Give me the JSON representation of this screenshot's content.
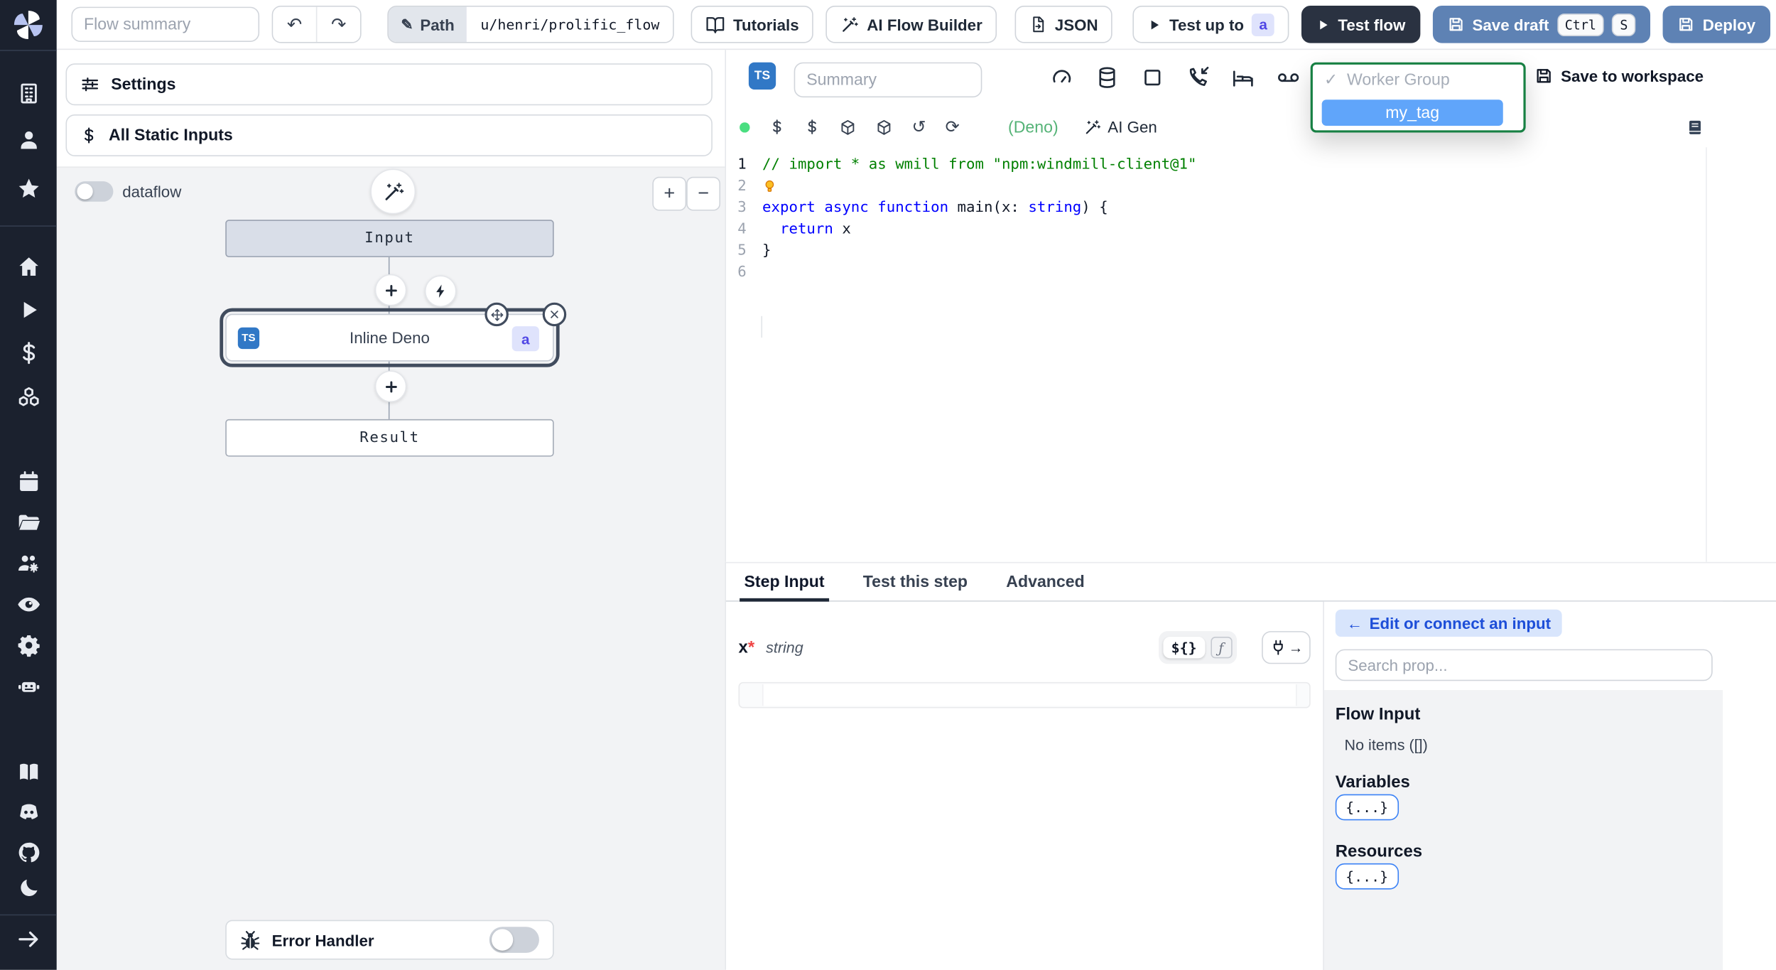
{
  "colors": {
    "sidebar_bg": "#1b212e",
    "primary_blue": "#5e82b4",
    "dark_button": "#2a3241",
    "badge_bg": "#dfe3fc",
    "badge_text": "#4f46e5",
    "ts_blue": "#3178c6",
    "selected_ring": "#414c5e",
    "dropdown_border": "#178043",
    "tag_bg": "#60a5fa",
    "canvas_bg": "#f2f3f5",
    "code_comment": "#008000",
    "code_keyword": "#0000ff",
    "deno_green": "#55b377",
    "link_blue": "#1d4ed8",
    "link_bg": "#d8e5fc",
    "obj_badge_border": "#3b82f6",
    "status_dot": "#4ade80"
  },
  "sidebar": {
    "items": [
      "windmill-logo",
      "building",
      "person",
      "star",
      "home",
      "play",
      "dollar",
      "cubes",
      "calendar",
      "folder-open",
      "users-gear",
      "eye",
      "gear",
      "robot",
      "book",
      "discord",
      "github",
      "moon",
      "arrow-right"
    ]
  },
  "topbar": {
    "flow_summary_placeholder": "Flow summary",
    "path_label": "Path",
    "path_value": "u/henri/prolific_flow",
    "tutorials_label": "Tutorials",
    "ai_flow_builder_label": "AI Flow Builder",
    "json_label": "JSON",
    "test_up_to_label": "Test up to",
    "test_up_to_badge": "a",
    "test_flow_label": "Test flow",
    "save_draft_label": "Save draft",
    "save_draft_kbd": [
      "Ctrl",
      "S"
    ],
    "deploy_label": "Deploy"
  },
  "flow_panel": {
    "settings_label": "Settings",
    "static_inputs_label": "All Static Inputs",
    "dataflow_label": "dataflow",
    "zoom_in_label": "+",
    "zoom_out_label": "−",
    "nodes": {
      "input_label": "Input",
      "step_label": "Inline Deno",
      "step_lang_badge": "TS",
      "step_id_badge": "a",
      "result_label": "Result"
    },
    "error_handler_label": "Error Handler"
  },
  "code_panel": {
    "lang_badge": "TS",
    "summary_placeholder": "Summary",
    "step_icons": [
      "retries",
      "concurrency",
      "cache",
      "early-stop",
      "suspend",
      "sleep",
      "mock"
    ],
    "meta_icons": [
      "status-dot",
      "dollar",
      "dollar",
      "cube",
      "cube",
      "rotate-ccw",
      "refresh"
    ],
    "deno_label": "(Deno)",
    "ai_gen_label": "AI Gen",
    "save_to_workspace_label": "Save to workspace",
    "worker_group_dropdown": {
      "check": "✓",
      "placeholder": "Worker Group",
      "option": "my_tag"
    },
    "code": {
      "lines": [
        {
          "n": "1",
          "tokens": [
            [
              "// import * as wmill from \"npm:windmill-client@1\"",
              "c"
            ]
          ]
        },
        {
          "n": "2",
          "tokens": [
            [
              "",
              "bulb"
            ]
          ]
        },
        {
          "n": "3",
          "tokens": [
            [
              "export async function ",
              "k"
            ],
            [
              "main(x: ",
              "p"
            ],
            [
              "string",
              "k"
            ],
            [
              ") {",
              "p"
            ]
          ]
        },
        {
          "n": "4",
          "tokens": [
            [
              "  ",
              "p"
            ],
            [
              "return",
              "k"
            ],
            [
              " x",
              "p"
            ]
          ]
        },
        {
          "n": "5",
          "tokens": [
            [
              "}",
              "p"
            ]
          ]
        },
        {
          "n": "6",
          "tokens": []
        }
      ]
    }
  },
  "bottom_panel": {
    "tabs": [
      {
        "label": "Step Input",
        "active": true
      },
      {
        "label": "Test this step",
        "active": false
      },
      {
        "label": "Advanced",
        "active": false
      }
    ],
    "field": {
      "name": "x",
      "required_mark": "*",
      "type": "string"
    },
    "expr_toggle": {
      "template_label": "${}",
      "fx_label": "ƒ"
    },
    "plug_arrow": "→",
    "right": {
      "edit_connect_arrow": "←",
      "edit_connect_label": "Edit or connect an input",
      "search_placeholder": "Search prop...",
      "flow_input_title": "Flow Input",
      "flow_input_empty": "No items ([])",
      "variables_title": "Variables",
      "variables_badge": "{...}",
      "resources_title": "Resources",
      "resources_badge": "{...}"
    }
  }
}
